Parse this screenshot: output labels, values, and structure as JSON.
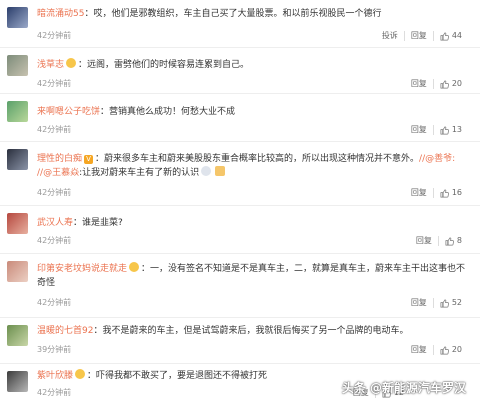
{
  "comments": [
    {
      "user": "暗流涌动55",
      "colon": "：",
      "text": "哎，他们是邪教组织，车主自己买了大量股票。和以前乐视股民一个德行",
      "time": "42分钟前",
      "report": "投诉",
      "reply": "回复",
      "likes": "44"
    },
    {
      "user": "浅草志",
      "colon": "：",
      "text": "远阁，雷劈他们的时候容易连累到自己。",
      "time": "42分钟前",
      "reply": "回复",
      "likes": "20"
    },
    {
      "user": "来啊嗯公子吃饼",
      "colon": "：",
      "text": "营销真他么成功！何愁大业不成",
      "time": "42分钟前",
      "reply": "回复",
      "likes": "13"
    },
    {
      "user": "理性的白痴",
      "colon": "：",
      "text": "蔚来很多车主和蔚来美股股东重合概率比较高的，所以出现这种情况并不意外。",
      "mention1": "//@善爷:",
      "mention2": "//@王慕焱",
      "text2": ":让我对蔚来车主有了新的认识",
      "time": "42分钟前",
      "reply": "回复",
      "likes": "16"
    },
    {
      "user": "武汉人寿",
      "colon": "：",
      "text": "谁是韭菜?",
      "time": "42分钟前",
      "reply": "回复",
      "likes": "8"
    },
    {
      "user": "印第安老坟妈说走就走",
      "colon": "：",
      "text": "一，没有签名不知道是不是真车主，二，就算是真车主，蔚来车主干出这事也不",
      "text2": "奇怪",
      "time": "42分钟前",
      "reply": "回复",
      "likes": "52"
    },
    {
      "user": "温暖的七首92",
      "colon": "：",
      "text": "我不是蔚来的车主，但是试驾蔚来后，我就很后悔买了另一个品牌的电动车。",
      "time": "39分钟前",
      "reply": "回复",
      "likes": "20"
    },
    {
      "user": "紫叶欣滕",
      "colon": "：",
      "text": "吓得我都不敢买了，要是退图还不得被打死",
      "time": "42分钟前",
      "reply": "回复",
      "likes": "12"
    }
  ],
  "watermark": "头条 @新能源汽车罗汉",
  "colors": {
    "link": "#eb7350",
    "text": "#333333",
    "muted": "#999999"
  },
  "icons": {
    "like": "thumbs-up-icon"
  }
}
